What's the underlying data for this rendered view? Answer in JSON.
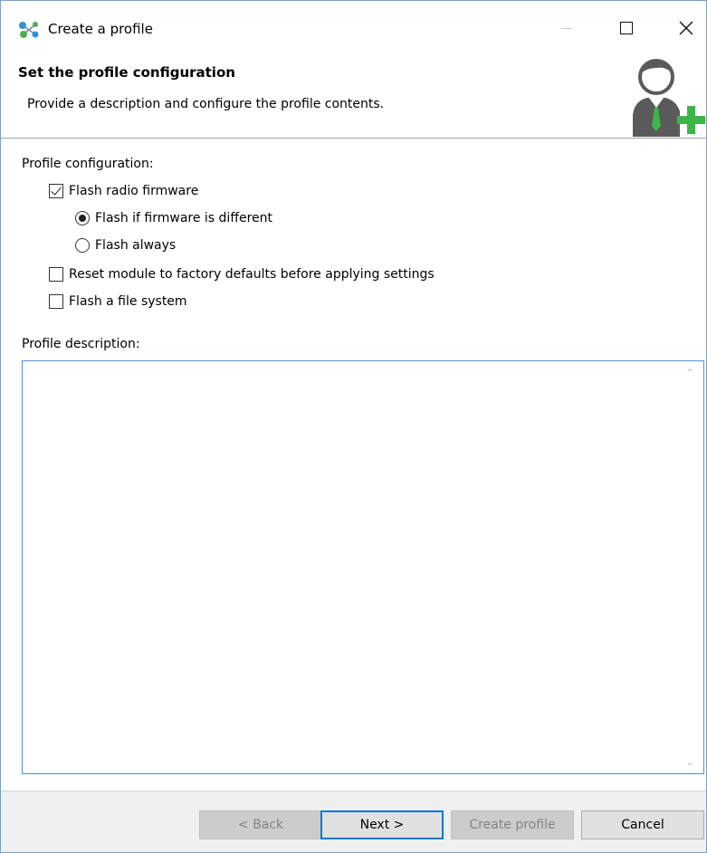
{
  "window": {
    "title": "Create a profile",
    "icon": "network-nodes-icon"
  },
  "banner": {
    "title": "Set the profile configuration",
    "description": "Provide a description and configure the profile contents.",
    "icon": "user-add-icon"
  },
  "config": {
    "label": "Profile configuration:",
    "flash_radio_firmware": {
      "label": "Flash radio firmware",
      "checked": true
    },
    "flash_if_different": {
      "label": "Flash if firmware is different",
      "selected": true
    },
    "flash_always": {
      "label": "Flash always",
      "selected": false
    },
    "reset_module": {
      "label": "Reset module to factory defaults before applying settings",
      "checked": false
    },
    "flash_file_system": {
      "label": "Flash a file system",
      "checked": false
    }
  },
  "description": {
    "label": "Profile description:",
    "value": ""
  },
  "buttons": {
    "back": "< Back",
    "next": "Next >",
    "create": "Create profile",
    "cancel": "Cancel"
  },
  "colors": {
    "accent": "#0078d7",
    "icon_green": "#3db54a",
    "icon_gray": "#5a5a5a"
  }
}
